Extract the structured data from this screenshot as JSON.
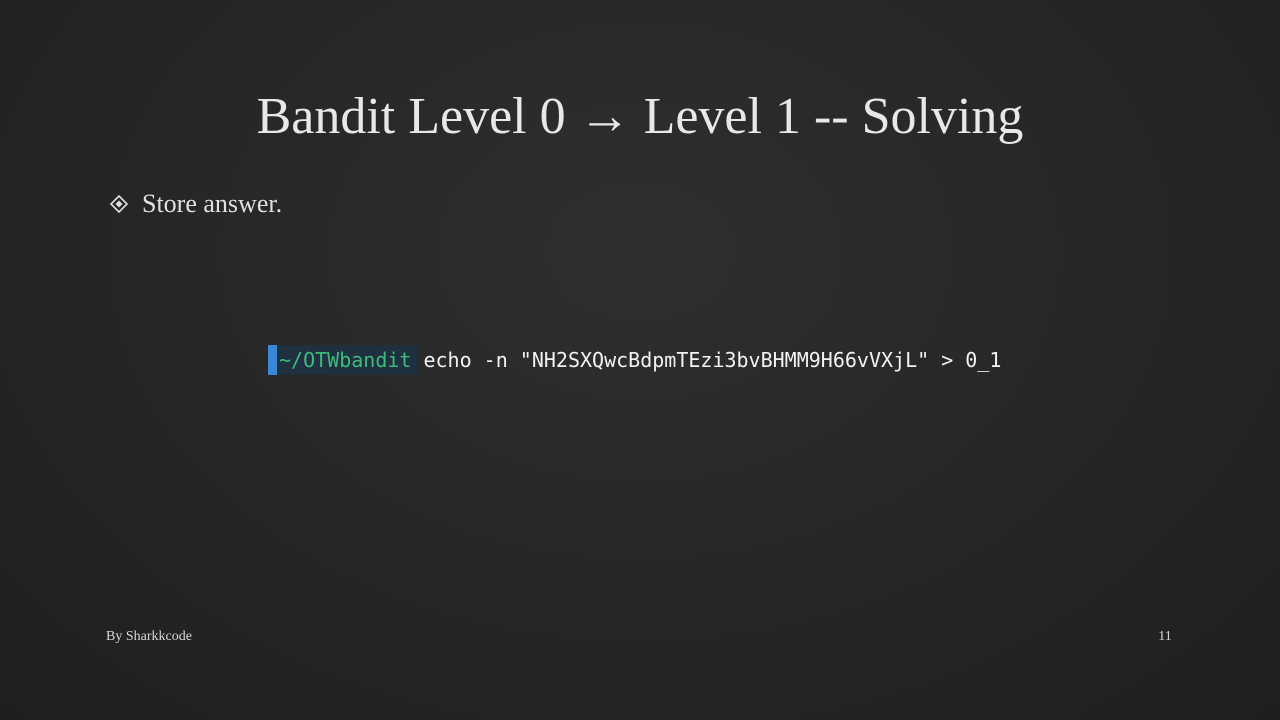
{
  "slide": {
    "title": "Bandit Level 0 → Level 1 -- Solving",
    "bullets": [
      {
        "text": "Store answer.",
        "icon": "diamond-bullet-icon"
      }
    ],
    "terminal": {
      "path": "~/OTWbandit",
      "command": "echo -n \"NH2SXQwcBdpmTEzi3bvBHMM9H66vVXjL\" > 0_1",
      "colors": {
        "cursor": "#3b86d6",
        "path": "#3fba7a",
        "command": "#f2f2f2"
      }
    },
    "footer": {
      "author": "By Sharkkcode",
      "page_number": "11"
    }
  }
}
